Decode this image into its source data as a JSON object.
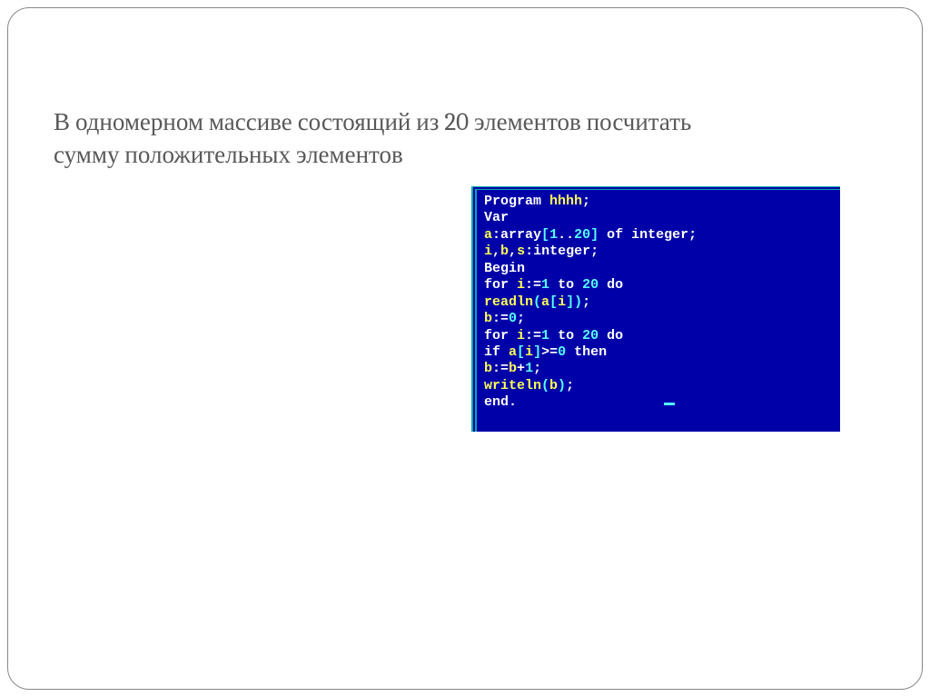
{
  "problem": "В одномерном массиве состоящий из 20 элементов посчитать сумму положительных элементов",
  "code": {
    "tokens": [
      [
        "kw",
        "Program "
      ],
      [
        "def",
        "hhhh"
      ],
      [
        "kw",
        ";"
      ],
      [
        "nl",
        ""
      ],
      [
        "kw",
        "Var"
      ],
      [
        "nl",
        ""
      ],
      [
        "def",
        "a"
      ],
      [
        "kw",
        ":"
      ],
      [
        "kw",
        "array"
      ],
      [
        "bkt",
        "["
      ],
      [
        "num",
        "1"
      ],
      [
        "kw",
        ".."
      ],
      [
        "num",
        "20"
      ],
      [
        "bkt",
        "]"
      ],
      [
        "kw",
        " of "
      ],
      [
        "typ",
        "integer"
      ],
      [
        "kw",
        ";"
      ],
      [
        "nl",
        ""
      ],
      [
        "def",
        "i"
      ],
      [
        "kw",
        ","
      ],
      [
        "def",
        "b"
      ],
      [
        "kw",
        ","
      ],
      [
        "def",
        "s"
      ],
      [
        "kw",
        ":"
      ],
      [
        "typ",
        "integer"
      ],
      [
        "kw",
        ";"
      ],
      [
        "nl",
        ""
      ],
      [
        "kw",
        "Begin"
      ],
      [
        "nl",
        ""
      ],
      [
        "kw",
        "for "
      ],
      [
        "def",
        "i"
      ],
      [
        "kw",
        ":="
      ],
      [
        "num",
        "1"
      ],
      [
        "kw",
        " to "
      ],
      [
        "num",
        "20"
      ],
      [
        "kw",
        " do"
      ],
      [
        "nl",
        ""
      ],
      [
        "def",
        "readln"
      ],
      [
        "bkt",
        "("
      ],
      [
        "def",
        "a"
      ],
      [
        "bkt",
        "["
      ],
      [
        "def",
        "i"
      ],
      [
        "bkt",
        "]"
      ],
      [
        "bkt",
        ")"
      ],
      [
        "kw",
        ";"
      ],
      [
        "nl",
        ""
      ],
      [
        "def",
        "b"
      ],
      [
        "kw",
        ":="
      ],
      [
        "num",
        "0"
      ],
      [
        "kw",
        ";"
      ],
      [
        "nl",
        ""
      ],
      [
        "kw",
        "for "
      ],
      [
        "def",
        "i"
      ],
      [
        "kw",
        ":="
      ],
      [
        "num",
        "1"
      ],
      [
        "kw",
        " to "
      ],
      [
        "num",
        "20"
      ],
      [
        "kw",
        " do"
      ],
      [
        "nl",
        ""
      ],
      [
        "kw",
        "if "
      ],
      [
        "def",
        "a"
      ],
      [
        "bkt",
        "["
      ],
      [
        "def",
        "i"
      ],
      [
        "bkt",
        "]"
      ],
      [
        "kw",
        ">="
      ],
      [
        "num",
        "0"
      ],
      [
        "kw",
        " then"
      ],
      [
        "nl",
        ""
      ],
      [
        "def",
        "b"
      ],
      [
        "kw",
        ":="
      ],
      [
        "def",
        "b"
      ],
      [
        "kw",
        "+"
      ],
      [
        "num",
        "1"
      ],
      [
        "kw",
        ";"
      ],
      [
        "nl",
        ""
      ],
      [
        "def",
        "writeln"
      ],
      [
        "bkt",
        "("
      ],
      [
        "def",
        "b"
      ],
      [
        "bkt",
        ")"
      ],
      [
        "kw",
        ";"
      ],
      [
        "nl",
        ""
      ],
      [
        "kw",
        "end"
      ],
      [
        "kw",
        "."
      ]
    ]
  }
}
